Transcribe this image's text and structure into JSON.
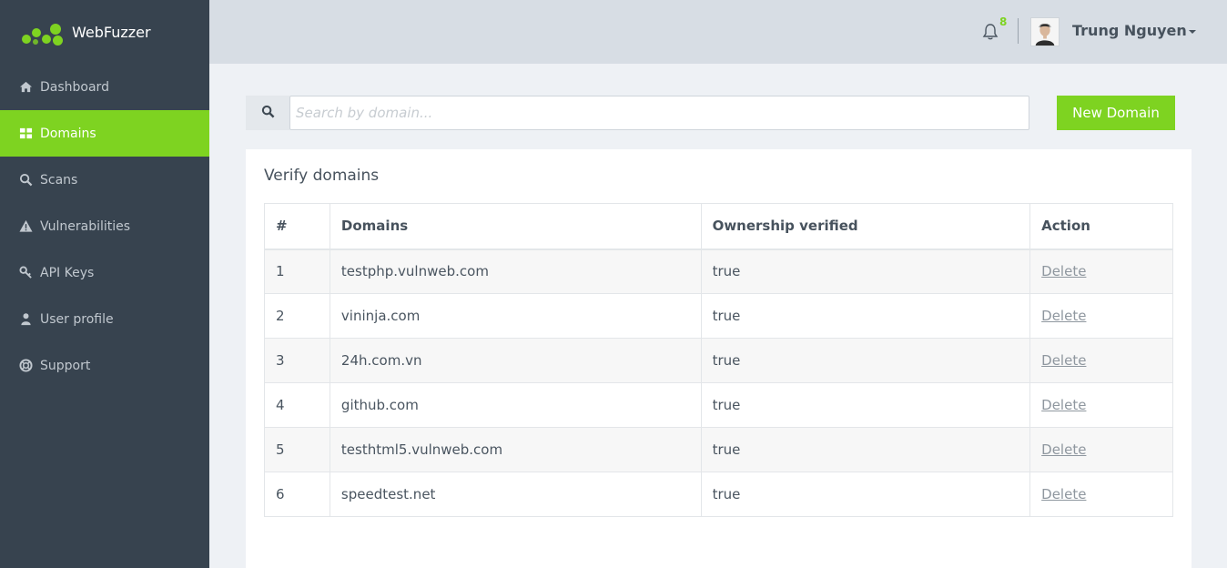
{
  "app": {
    "name": "WebFuzzer"
  },
  "sidebar": {
    "items": [
      {
        "label": "Dashboard",
        "icon": "home-icon",
        "active": false
      },
      {
        "label": "Domains",
        "icon": "grid-icon",
        "active": true
      },
      {
        "label": "Scans",
        "icon": "search-icon",
        "active": false
      },
      {
        "label": "Vulnerabilities",
        "icon": "warning-icon",
        "active": false
      },
      {
        "label": "API Keys",
        "icon": "key-icon",
        "active": false
      },
      {
        "label": "User profile",
        "icon": "user-icon",
        "active": false
      },
      {
        "label": "Support",
        "icon": "lifebuoy-icon",
        "active": false
      }
    ]
  },
  "header": {
    "notifications_count": "8",
    "user_name": "Trung Nguyen"
  },
  "search": {
    "placeholder": "Search by domain...",
    "value": ""
  },
  "toolbar": {
    "new_domain_label": "New Domain"
  },
  "card": {
    "title": "Verify domains",
    "columns": [
      "#",
      "Domains",
      "Ownership verified",
      "Action"
    ],
    "rows": [
      {
        "num": "1",
        "domain": "testphp.vulnweb.com",
        "verified": "true",
        "action": "Delete"
      },
      {
        "num": "2",
        "domain": "vininja.com",
        "verified": "true",
        "action": "Delete"
      },
      {
        "num": "3",
        "domain": "24h.com.vn",
        "verified": "true",
        "action": "Delete"
      },
      {
        "num": "4",
        "domain": "github.com",
        "verified": "true",
        "action": "Delete"
      },
      {
        "num": "5",
        "domain": "testhtml5.vulnweb.com",
        "verified": "true",
        "action": "Delete"
      },
      {
        "num": "6",
        "domain": "speedtest.net",
        "verified": "true",
        "action": "Delete"
      }
    ]
  },
  "colors": {
    "accent": "#7ed321",
    "sidebar": "#37434f",
    "topbar": "#d7dde4"
  }
}
